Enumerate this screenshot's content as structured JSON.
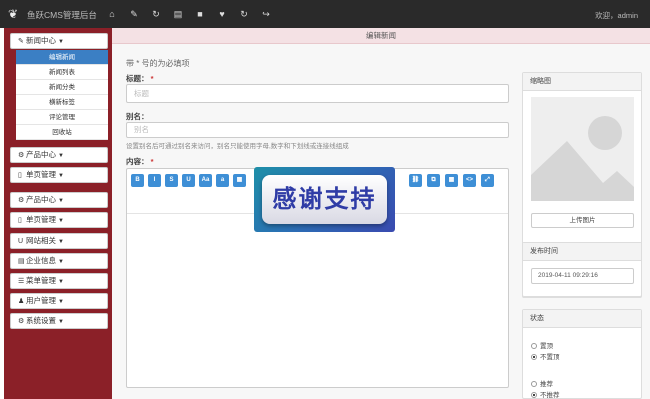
{
  "topbar": {
    "brand": "鱼跃CMS管理后台",
    "icons": [
      "home-icon",
      "pencil-icon",
      "refresh-alt-icon",
      "file-icon",
      "lock-icon",
      "heart-icon",
      "refresh-icon",
      "logout-icon"
    ],
    "icon_glyphs": [
      "⌂",
      "✎",
      "↻",
      "▤",
      "🔒",
      "♥",
      "↻",
      "↪"
    ],
    "user": "欢迎，admin"
  },
  "sidebar": {
    "news": {
      "label": "新闻中心",
      "icon": "✎"
    },
    "sub_items": [
      "编辑新闻",
      "新闻列表",
      "新闻分类",
      "横新标签",
      "评论管理",
      "回收站"
    ],
    "menus": [
      {
        "label": "产品中心",
        "icon": "⚙"
      },
      {
        "label": "单页管理",
        "icon": "▯"
      },
      {
        "label": "产品中心",
        "icon": "⚙"
      },
      {
        "label": "单页管理",
        "icon": "▯"
      },
      {
        "label": "网站相关",
        "icon": "U"
      },
      {
        "label": "企业信息",
        "icon": "▤"
      },
      {
        "label": "菜单管理",
        "icon": "☰"
      },
      {
        "label": "用户管理",
        "icon": "♟"
      },
      {
        "label": "系统设置",
        "icon": "⚙"
      }
    ]
  },
  "breadcrumb": "编辑新闻",
  "form": {
    "hint": "带 * 号的为必填项",
    "title_label": "标题：",
    "title_placeholder": "标题",
    "alias_label": "别名：",
    "alias_placeholder": "别名",
    "alias_help": "设置别名后可通过别名来访问，别名只能使用字母,数字和下划线或连接线组成",
    "content_label": "内容：",
    "req": "*",
    "toolbar_row1": [
      "B",
      "I",
      "S",
      "U",
      "A",
      "a",
      "▦"
    ],
    "toolbar_row1b": [
      "⛓",
      "⧉",
      "▦",
      "<>",
      "⤢"
    ],
    "toolbar_row2": [
      "▢",
      "🗑",
      "",
      "▣",
      "☺",
      "x₂",
      "x²"
    ]
  },
  "panels": {
    "thumb": {
      "title": "缩略图",
      "upload": "上传图片"
    },
    "publish": {
      "title": "发布时间",
      "value": "2019-04-11 09:29:16"
    },
    "status": {
      "title": "状态",
      "opt1": "置顶",
      "opt2": "不置顶",
      "opt3": "推荐",
      "opt4": "不推荐"
    }
  },
  "watermark": "感谢支持"
}
